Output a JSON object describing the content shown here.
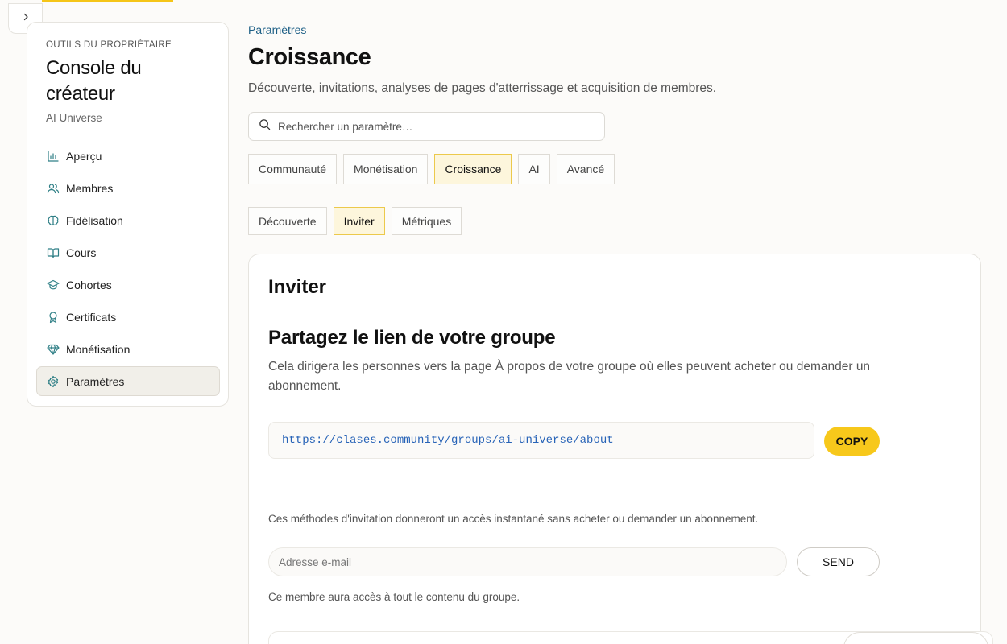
{
  "sidebar": {
    "owner_label": "OUTILS DU PROPRIÉTAIRE",
    "title": "Console du créateur",
    "subtitle": "AI Universe",
    "items": [
      {
        "label": "Aperçu",
        "icon": "bar-chart-icon"
      },
      {
        "label": "Membres",
        "icon": "users-icon"
      },
      {
        "label": "Fidélisation",
        "icon": "brain-icon"
      },
      {
        "label": "Cours",
        "icon": "book-icon"
      },
      {
        "label": "Cohortes",
        "icon": "graduation-cap-icon"
      },
      {
        "label": "Certificats",
        "icon": "award-icon"
      },
      {
        "label": "Monétisation",
        "icon": "gem-icon"
      },
      {
        "label": "Paramètres",
        "icon": "gear-icon",
        "active": true
      }
    ]
  },
  "header": {
    "breadcrumb": "Paramètres",
    "title": "Croissance",
    "description": "Découverte, invitations, analyses de pages d'atterrissage et acquisition de membres."
  },
  "search": {
    "placeholder": "Rechercher un paramètre…"
  },
  "tabs": {
    "primary": [
      "Communauté",
      "Monétisation",
      "Croissance",
      "AI",
      "Avancé"
    ],
    "primary_active": "Croissance",
    "secondary": [
      "Découverte",
      "Inviter",
      "Métriques"
    ],
    "secondary_active": "Inviter"
  },
  "invite_card": {
    "title": "Inviter",
    "share_heading": "Partagez le lien de votre groupe",
    "share_description": "Cela dirigera les personnes vers la page À propos de votre groupe où elles peuvent acheter ou demander un abonnement.",
    "group_link": "https://clases.community/groups/ai-universe/about",
    "copy_label": "COPY",
    "invite_note": "Ces méthodes d'invitation donneront un accès instantané sans acheter ou demander un abonnement.",
    "email_placeholder": "Adresse e-mail",
    "send_label": "SEND",
    "member_note": "Ce membre aura accès à tout le contenu du groupe."
  },
  "colors": {
    "accent": "#f7c81b",
    "link": "#2763b7",
    "breadcrumb": "#1d5f86",
    "icon_teal": "#2f7f86"
  }
}
